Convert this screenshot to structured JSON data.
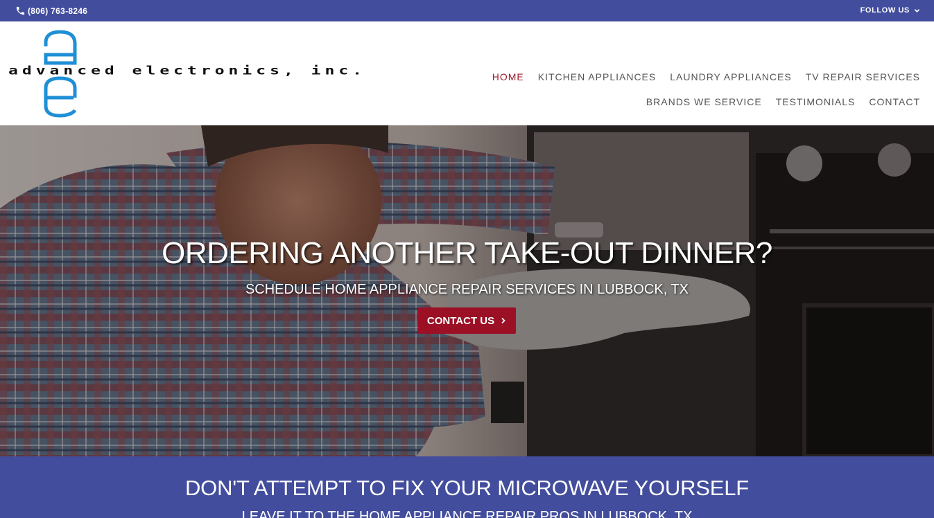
{
  "topbar": {
    "phone": "(806) 763-8246",
    "follow_label": "FOLLOW US",
    "phone_icon": "phone-icon",
    "follow_icon": "chevron-down-icon"
  },
  "logo": {
    "mark_letters": "ae",
    "wordmark": "advanced electronics, inc.",
    "brand_color": "#1f8fd6"
  },
  "nav": {
    "items": [
      {
        "label": "HOME",
        "active": true
      },
      {
        "label": "KITCHEN APPLIANCES",
        "active": false
      },
      {
        "label": "LAUNDRY APPLIANCES",
        "active": false
      },
      {
        "label": "TV REPAIR SERVICES",
        "active": false
      },
      {
        "label": "BRANDS WE SERVICE",
        "active": false
      },
      {
        "label": "TESTIMONIALS",
        "active": false
      },
      {
        "label": "CONTACT",
        "active": false
      }
    ]
  },
  "hero": {
    "title": "ORDERING ANOTHER TAKE-OUT DINNER?",
    "subtitle": "SCHEDULE HOME APPLIANCE REPAIR SERVICES IN LUBBOCK, TX",
    "cta_label": "CONTACT US",
    "cta_icon": "chevron-right-icon"
  },
  "band": {
    "title": "DON'T ATTEMPT TO FIX YOUR MICROWAVE YOURSELF",
    "subtitle": "LEAVE IT TO THE HOME APPLIANCE REPAIR PROS IN LUBBOCK, TX"
  },
  "colors": {
    "topbar_bg": "#434d9d",
    "nav_active": "#9b1c2e",
    "nav_text": "#555555",
    "cta_bg": "#9b1025",
    "band_bg": "#434d9d"
  }
}
